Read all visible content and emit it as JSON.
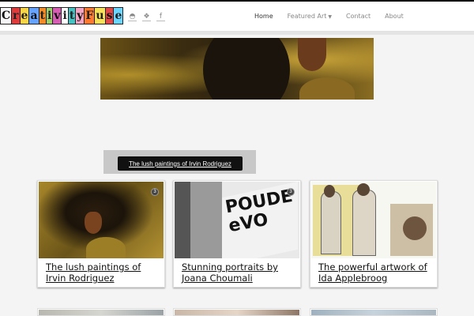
{
  "header": {
    "logo_letters": [
      "C",
      "r",
      "e",
      "a",
      "t",
      "i",
      "v",
      "i",
      "t",
      "y",
      "F",
      "u",
      "s",
      "e"
    ],
    "logo_colors": [
      "#f5f5f5",
      "#e03b3b",
      "#f7d547",
      "#66a3ff",
      "#f28c28",
      "#9bd06b",
      "#d65db1",
      "#ffffff",
      "#46c2c2",
      "#f2a6c4",
      "#ff7a2f",
      "#f7e15a",
      "#e24a4a",
      "#6bd6ff"
    ],
    "social": [
      "rss-icon",
      "twitter-icon",
      "facebook-icon"
    ],
    "nav": [
      {
        "label": "Home",
        "active": true
      },
      {
        "label": "Featured Art",
        "dropdown": true
      },
      {
        "label": "Contact"
      },
      {
        "label": "About"
      }
    ]
  },
  "banner": {
    "label": "The lush paintings of Irvin Rodriguez"
  },
  "cards": [
    {
      "title": "The lush paintings of Irvin Rodriguez",
      "badge": "3"
    },
    {
      "title": "Stunning portraits by Joana Choumali",
      "badge": "3",
      "thumb_text": "POUDE\neVO"
    },
    {
      "title": "The powerful artwork of Ida Applebroog"
    }
  ]
}
